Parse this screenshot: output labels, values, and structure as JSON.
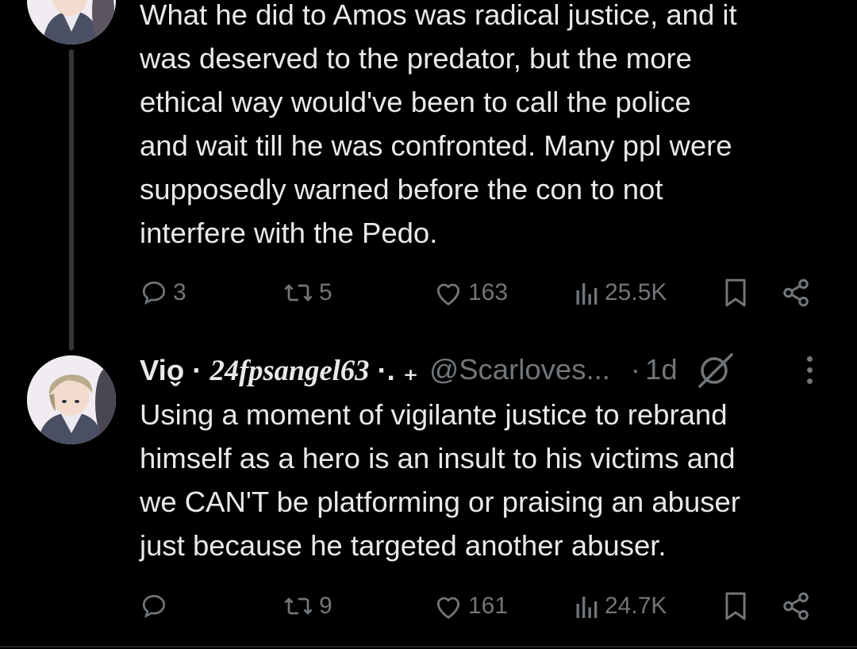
{
  "thread": {
    "reply_1": {
      "text_lines": [
        "What he did to Amos was radical justice, and it",
        "was deserved to the predator, but the more",
        "ethical way would've been to call the police",
        "and wait till he was confronted. Many ppl were",
        "supposedly warned before the con to not",
        "interfere with the Pedo."
      ],
      "actions": {
        "replies": "3",
        "reposts": "5",
        "likes": "163",
        "views": "25.5K"
      }
    },
    "reply_2": {
      "display_name_plain": "Vio",
      "display_name_mark": "̬",
      "display_name_sep": " · ",
      "display_name_fancy": "24fpsangel63",
      "display_name_suffix": " ·. ₊",
      "handle": "@Scarloves...",
      "time_sep": "·",
      "time": "1d",
      "text_lines": [
        "Using a moment of vigilante justice to rebrand",
        "himself as a hero is an insult to his victims and",
        "we CAN'T be platforming or praising an abuser",
        "just because he targeted another abuser."
      ],
      "actions": {
        "replies": "",
        "reposts": "9",
        "likes": "161",
        "views": "24.7K"
      }
    }
  },
  "icons": {
    "reply": "reply-icon",
    "repost": "repost-icon",
    "like": "heart-icon",
    "views": "views-bar-chart-icon",
    "bookmark": "bookmark-icon",
    "share": "share-icon",
    "grok": "grok-icon",
    "more": "more-vertical-icon"
  },
  "colors": {
    "background": "#000000",
    "text": "#e7e9ea",
    "muted": "#71767b",
    "thread_line": "#333639"
  }
}
